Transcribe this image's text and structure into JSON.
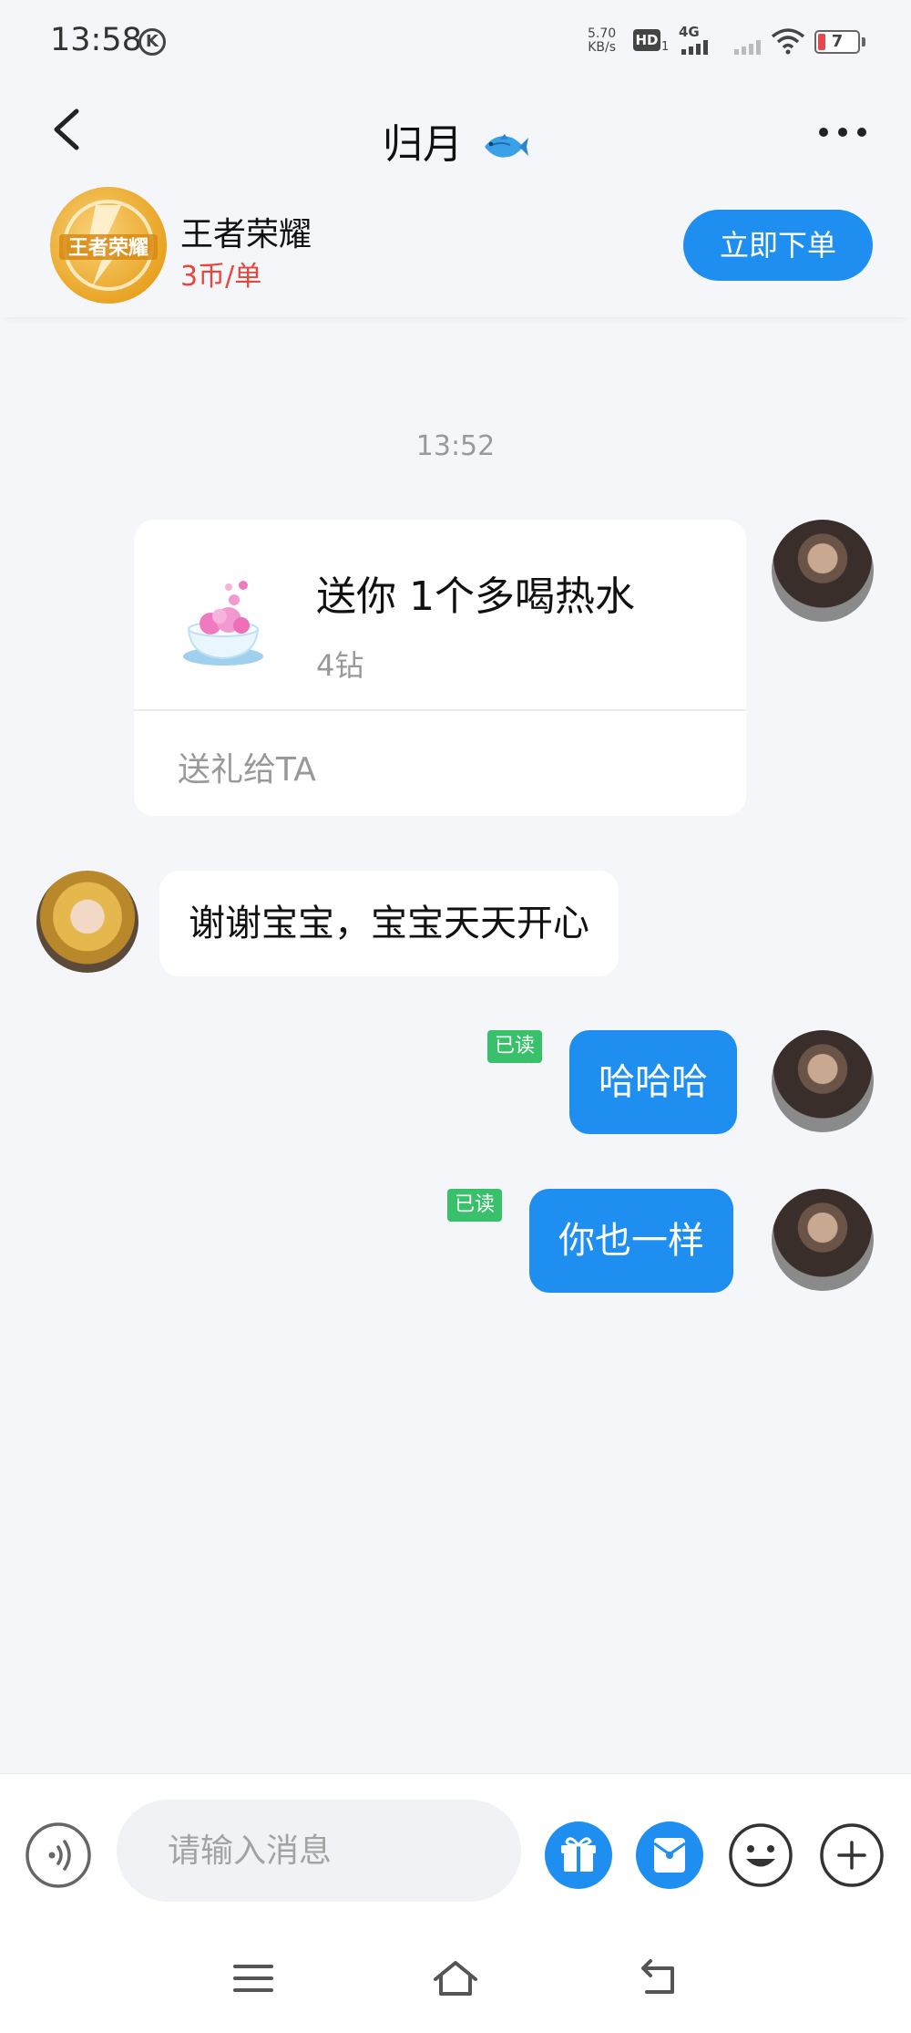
{
  "status_bar": {
    "time": "13:58",
    "net_speed_value": "5.70",
    "net_speed_unit": "KB/s",
    "hd_label": "HD",
    "hd_sub": "1",
    "network_label": "4G",
    "battery_level": "7"
  },
  "header": {
    "title": "归月"
  },
  "product": {
    "name": "王者荣耀",
    "price": "3币/单",
    "logo_text": "王者荣耀",
    "order_button": "立即下单"
  },
  "chat": {
    "timestamp": "13:52",
    "gift": {
      "title": "送你 1个多喝热水",
      "price": "4钻",
      "action": "送礼给TA"
    },
    "messages": [
      {
        "from": "them",
        "text": "谢谢宝宝，宝宝天天开心"
      },
      {
        "from": "me",
        "text": "哈哈哈",
        "status": "已读"
      },
      {
        "from": "me",
        "text": "你也一样",
        "status": "已读"
      }
    ]
  },
  "input_bar": {
    "placeholder": "请输入消息"
  },
  "colors": {
    "accent": "#1e8ff0",
    "price_red": "#e8453c",
    "read_green": "#39c06a",
    "background": "#f4f6f9"
  }
}
